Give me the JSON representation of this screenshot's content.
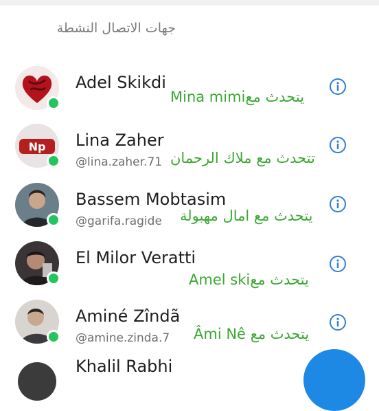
{
  "section_header": "جهات الاتصال النشطة",
  "contacts": [
    {
      "name": "Adel Skikdi",
      "username": "",
      "talking": "يتحدث معMina mimi"
    },
    {
      "name": "Lina Zaher",
      "username": "@lina.zaher.71",
      "talking": "تتحدث مع ملاك الرحمان"
    },
    {
      "name": "Bassem Mobtasim",
      "username": "@garifa.ragide",
      "talking": "يتحدث مع امال مهبولة"
    },
    {
      "name": "El Milor Veratti",
      "username": "",
      "talking": "يتحدث معAmel ski"
    },
    {
      "name": "Aminé Zîndã",
      "username": "@amine.zinda.7",
      "talking": "يتحدث مع Âmi Nê"
    },
    {
      "name": "Khalil Rabhi",
      "username": "",
      "talking": ""
    }
  ],
  "colors": {
    "online": "#22c55e",
    "talking_text": "#3aa832",
    "info_icon": "#2f7dd8",
    "fab": "#1e88e5"
  },
  "icons": {
    "info": "info-circle-icon",
    "online": "online-status-dot"
  }
}
